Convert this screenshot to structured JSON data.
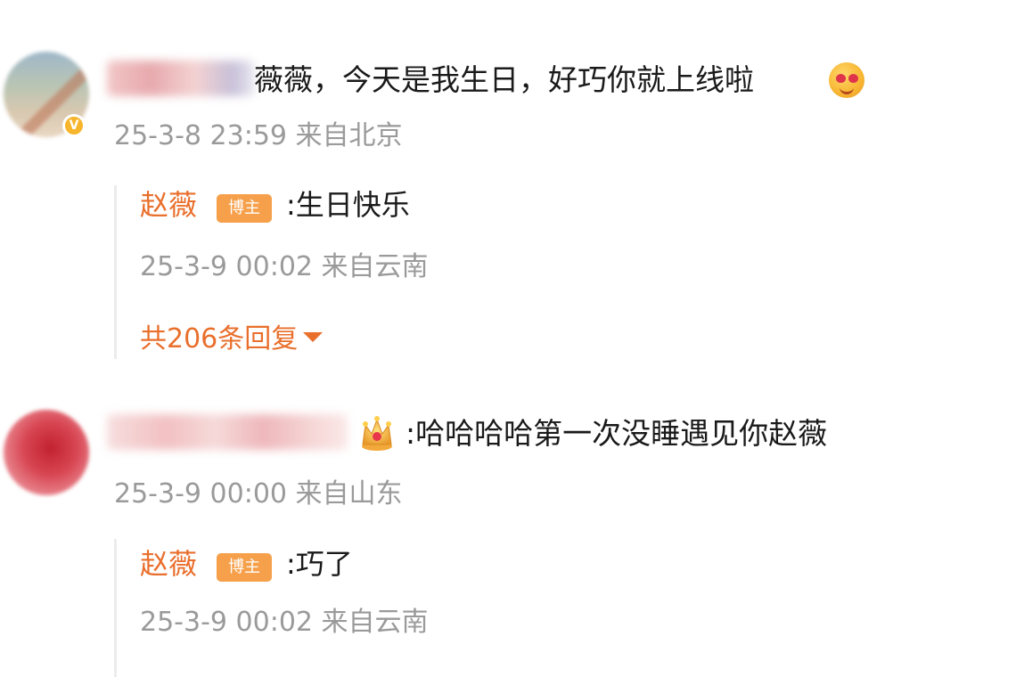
{
  "comments": [
    {
      "text": "薇薇，今天是我生日，好巧你就上线啦",
      "emoji_icon": "heart-eyes-emoji-icon",
      "time": "25-3-8 23:59",
      "location": "来自北京",
      "verified": true,
      "reply": {
        "author": "赵薇",
        "tag": "博主",
        "text": ":生日快乐",
        "time": "25-3-9 00:02",
        "location": "来自云南"
      },
      "more_replies": "共206条回复"
    },
    {
      "badge_icon": "crown-icon",
      "text": ":哈哈哈哈第一次没睡遇见你赵薇",
      "time": "25-3-9 00:00",
      "location": "来自山东",
      "reply": {
        "author": "赵薇",
        "tag": "博主",
        "text": ":巧了",
        "time": "25-3-9 00:02",
        "location": "来自云南"
      }
    }
  ],
  "colors": {
    "accent": "#e96f2c",
    "tag_bg": "#f6a04b",
    "meta": "#9a9a9a",
    "verified_badge": "#f7b52c"
  }
}
